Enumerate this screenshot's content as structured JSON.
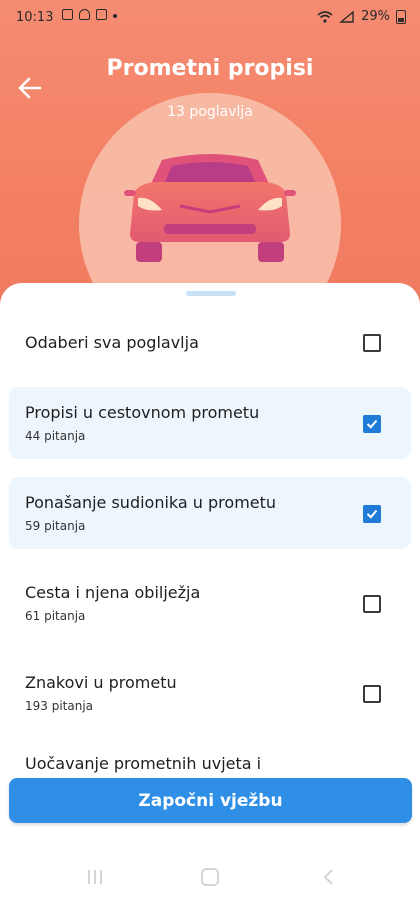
{
  "status_bar": {
    "time": "10:13",
    "battery": "29%"
  },
  "header": {
    "title": "Prometni propisi",
    "subtitle": "13 poglavlja"
  },
  "select_all": {
    "label": "Odaberi sva poglavlja",
    "checked": false
  },
  "chapters": [
    {
      "name": "Propisi u cestovnom prometu",
      "count": "44 pitanja",
      "checked": true
    },
    {
      "name": "Ponašanje sudionika u prometu",
      "count": "59 pitanja",
      "checked": true
    },
    {
      "name": "Cesta i njena obilježja",
      "count": "61 pitanja",
      "checked": false
    },
    {
      "name": "Znakovi u prometu",
      "count": "193 pitanja",
      "checked": false
    },
    {
      "name": "Uočavanje prometnih uvjeta i"
    }
  ],
  "start_button": {
    "label": "Započni vježbu"
  },
  "colors": {
    "accent": "#2f8fe7",
    "header": "#f37d63",
    "selected_row": "#eef6fd"
  },
  "icons": [
    "back-arrow-icon",
    "car-icon",
    "checkbox-icon",
    "wifi-icon",
    "battery-icon"
  ]
}
